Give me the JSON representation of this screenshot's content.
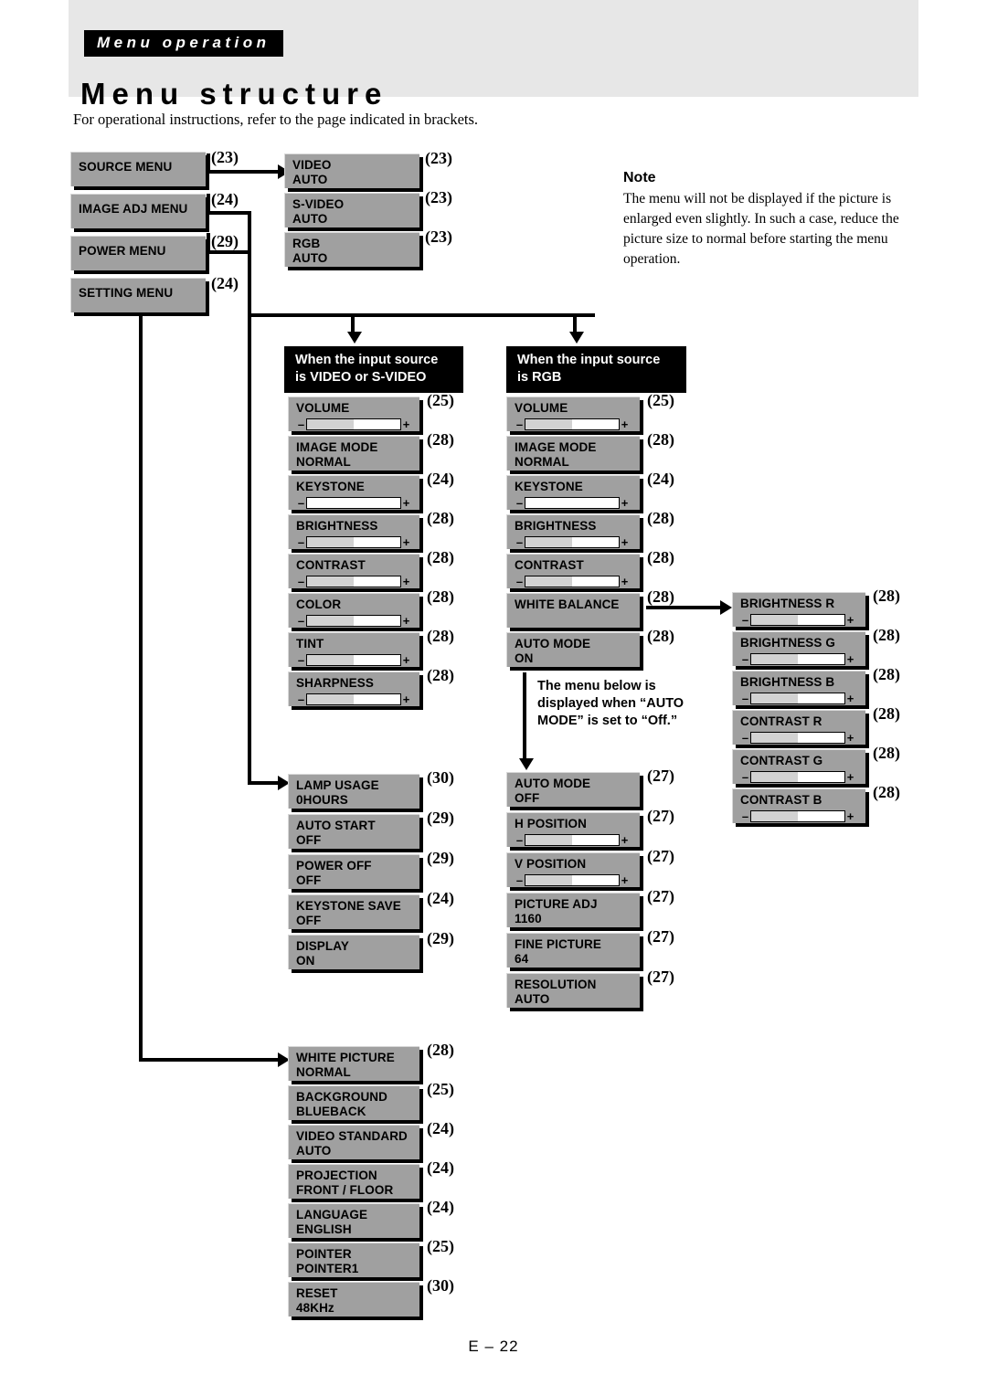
{
  "header": {
    "kicker": "Menu operation",
    "title": "Menu structure",
    "intro": "For operational instructions, refer to the page indicated in brackets."
  },
  "note": {
    "title": "Note",
    "body": "The menu will not be displayed if the picture is enlarged even slightly. In such a case, reduce the picture size to normal before starting the menu operation."
  },
  "footer": {
    "page": "E – 22"
  },
  "top_menus": [
    {
      "label": "SOURCE MENU",
      "ref": "(23)"
    },
    {
      "label": "IMAGE ADJ MENU",
      "ref": "(24)"
    },
    {
      "label": "POWER MENU",
      "ref": "(29)"
    },
    {
      "label": "SETTING MENU",
      "ref": "(24)"
    }
  ],
  "source_items": [
    {
      "label": "VIDEO",
      "value": "AUTO",
      "ref": "(23)"
    },
    {
      "label": "S-VIDEO",
      "value": "AUTO",
      "ref": "(23)"
    },
    {
      "label": "RGB",
      "value": "AUTO",
      "ref": "(23)"
    }
  ],
  "video_header": "When the input source is VIDEO or S-VIDEO",
  "video_header_l1": "When the input source",
  "video_header_l2": "is VIDEO or S-VIDEO",
  "video_items": [
    {
      "label": "VOLUME",
      "ref": "(25)",
      "slider": true,
      "fill": 50,
      "value": ""
    },
    {
      "label": "IMAGE MODE",
      "ref": "(28)",
      "slider": false,
      "value": "NORMAL"
    },
    {
      "label": "KEYSTONE",
      "ref": "(24)",
      "slider": true,
      "fill": 0,
      "value": ""
    },
    {
      "label": "BRIGHTNESS",
      "ref": "(28)",
      "slider": true,
      "fill": 50,
      "value": ""
    },
    {
      "label": "CONTRAST",
      "ref": "(28)",
      "slider": true,
      "fill": 50,
      "value": ""
    },
    {
      "label": "COLOR",
      "ref": "(28)",
      "slider": true,
      "fill": 50,
      "value": ""
    },
    {
      "label": "TINT",
      "ref": "(28)",
      "slider": true,
      "fill": 50,
      "value": ""
    },
    {
      "label": "SHARPNESS",
      "ref": "(28)",
      "slider": true,
      "fill": 50,
      "value": ""
    }
  ],
  "rgb_header_l1": "When the input source",
  "rgb_header_l2": "is RGB",
  "rgb_items": [
    {
      "label": "VOLUME",
      "ref": "(25)",
      "slider": true,
      "fill": 50,
      "value": ""
    },
    {
      "label": "IMAGE MODE",
      "ref": "(28)",
      "slider": false,
      "value": "NORMAL"
    },
    {
      "label": "KEYSTONE",
      "ref": "(24)",
      "slider": true,
      "fill": 0,
      "value": ""
    },
    {
      "label": "BRIGHTNESS",
      "ref": "(28)",
      "slider": true,
      "fill": 50,
      "value": ""
    },
    {
      "label": "CONTRAST",
      "ref": "(28)",
      "slider": true,
      "fill": 50,
      "value": ""
    },
    {
      "label": "WHITE BALANCE",
      "ref": "(28)",
      "slider": false,
      "value": ""
    },
    {
      "label": "AUTO MODE",
      "ref": "(28)",
      "slider": false,
      "value": "ON"
    }
  ],
  "auto_mode_note_l1": "The menu below is",
  "auto_mode_note_l2": "displayed when “AUTO",
  "auto_mode_note_l3": "MODE” is set to “Off.”",
  "auto_off_items": [
    {
      "label": "AUTO MODE",
      "ref": "(27)",
      "slider": false,
      "value": "OFF"
    },
    {
      "label": "H POSITION",
      "ref": "(27)",
      "slider": true,
      "fill": 50,
      "value": ""
    },
    {
      "label": "V POSITION",
      "ref": "(27)",
      "slider": true,
      "fill": 50,
      "value": ""
    },
    {
      "label": "PICTURE ADJ",
      "ref": "(27)",
      "slider": false,
      "value": "1160"
    },
    {
      "label": "FINE PICTURE",
      "ref": "(27)",
      "slider": false,
      "value": "64"
    },
    {
      "label": "RESOLUTION",
      "ref": "(27)",
      "slider": false,
      "value": "AUTO"
    }
  ],
  "white_balance_items": [
    {
      "label": "BRIGHTNESS R",
      "ref": "(28)",
      "slider": true,
      "fill": 50
    },
    {
      "label": "BRIGHTNESS G",
      "ref": "(28)",
      "slider": true,
      "fill": 50
    },
    {
      "label": "BRIGHTNESS B",
      "ref": "(28)",
      "slider": true,
      "fill": 50
    },
    {
      "label": "CONTRAST R",
      "ref": "(28)",
      "slider": true,
      "fill": 50
    },
    {
      "label": "CONTRAST G",
      "ref": "(28)",
      "slider": true,
      "fill": 50
    },
    {
      "label": "CONTRAST B",
      "ref": "(28)",
      "slider": true,
      "fill": 50
    }
  ],
  "power_items": [
    {
      "label": "LAMP USAGE",
      "ref": "(30)",
      "value": "0HOURS"
    },
    {
      "label": "AUTO START",
      "ref": "(29)",
      "value": "OFF"
    },
    {
      "label": "POWER OFF",
      "ref": "(29)",
      "value": "OFF"
    },
    {
      "label": "KEYSTONE SAVE",
      "ref": "(24)",
      "value": "OFF"
    },
    {
      "label": "DISPLAY",
      "ref": "(29)",
      "value": "ON"
    }
  ],
  "setting_items": [
    {
      "label": "WHITE PICTURE",
      "ref": "(28)",
      "value": "NORMAL"
    },
    {
      "label": "BACKGROUND",
      "ref": "(25)",
      "value": "BLUEBACK"
    },
    {
      "label": "VIDEO STANDARD",
      "ref": "(24)",
      "value": "AUTO"
    },
    {
      "label": "PROJECTION",
      "ref": "(24)",
      "value": "FRONT / FLOOR"
    },
    {
      "label": "LANGUAGE",
      "ref": "(24)",
      "value": "ENGLISH"
    },
    {
      "label": "POINTER",
      "ref": "(25)",
      "value": "POINTER1"
    },
    {
      "label": "RESET",
      "ref": "(30)",
      "value": "48KHz"
    }
  ],
  "colors": {
    "box_fill": "#a0a0a0",
    "header_band": "#e7e7e7",
    "slider_fill": "#d2d2d2",
    "ink": "#000000"
  }
}
